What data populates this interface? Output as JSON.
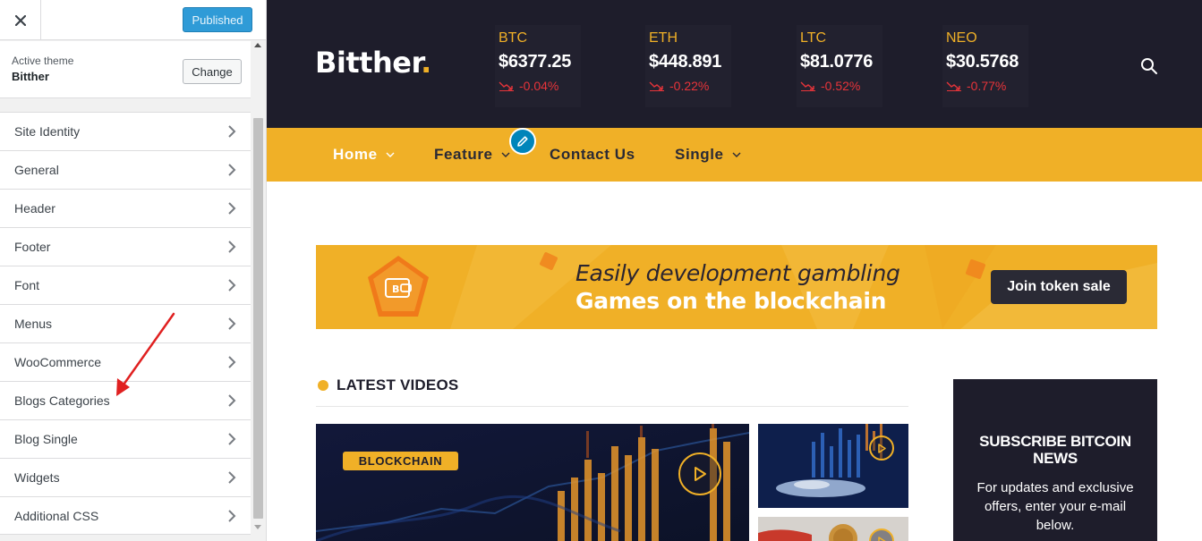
{
  "customizer": {
    "publish_label": "Published",
    "active_theme_label": "Active theme",
    "theme_name": "Bitther",
    "change_label": "Change",
    "menu_items": [
      {
        "label": "Site Identity"
      },
      {
        "label": "General"
      },
      {
        "label": "Header"
      },
      {
        "label": "Footer"
      },
      {
        "label": "Font"
      },
      {
        "label": "Menus"
      },
      {
        "label": "WooCommerce"
      },
      {
        "label": "Blogs Categories"
      },
      {
        "label": "Blog Single"
      },
      {
        "label": "Widgets"
      },
      {
        "label": "Additional CSS"
      }
    ],
    "annotation_arrow_color": "#e02020",
    "publish_color": "#2f9bd7"
  },
  "site": {
    "logo": "Bitther",
    "logo_dot": ".",
    "tickers": [
      {
        "symbol": "BTC",
        "price": "$6377.25",
        "change": "-0.04%"
      },
      {
        "symbol": "ETH",
        "price": "$448.891",
        "change": "-0.22%"
      },
      {
        "symbol": "LTC",
        "price": "$81.0776",
        "change": "-0.52%"
      },
      {
        "symbol": "NEO",
        "price": "$30.5768",
        "change": "-0.77%"
      }
    ],
    "nav": [
      {
        "label": "Home",
        "dropdown": true,
        "active": true
      },
      {
        "label": "Feature",
        "dropdown": true,
        "active": false
      },
      {
        "label": "Contact Us",
        "dropdown": false,
        "active": false
      },
      {
        "label": "Single",
        "dropdown": true,
        "active": false
      }
    ],
    "banner": {
      "line1": "Easily development gambling",
      "line2": "Games on the blockchain",
      "button": "Join token sale"
    },
    "latest_videos": {
      "title": "LATEST VIDEOS",
      "main_tag": "BLOCKCHAIN"
    },
    "subscribe": {
      "title": "SUBSCRIBE BITCOIN NEWS",
      "text": "For updates and exclusive offers, enter your e-mail below."
    },
    "colors": {
      "header_bg": "#1e1d2b",
      "accent": "#f0b027",
      "negative": "#e8343a"
    }
  }
}
